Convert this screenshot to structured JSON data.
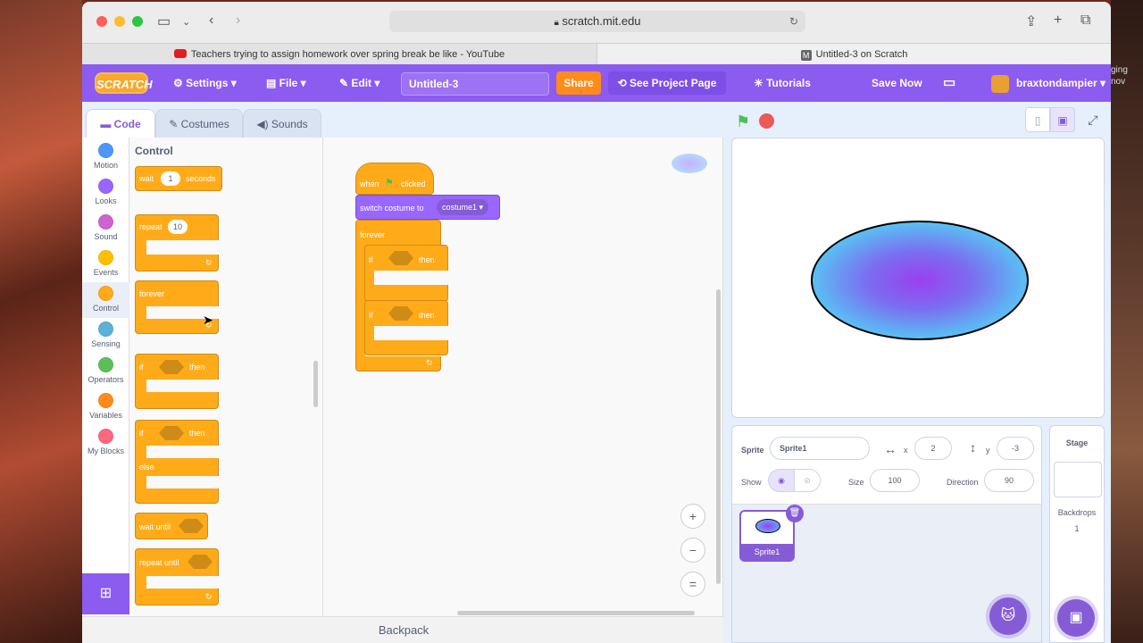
{
  "browser": {
    "url": "scratch.mit.edu",
    "tabs": [
      {
        "label": "Teachers trying to assign homework over spring break be like - YouTube"
      },
      {
        "label": "Untitled-3 on Scratch"
      }
    ],
    "background_side_text": "ging\nnov"
  },
  "menubar": {
    "logo": "SCRATCH",
    "settings": "Settings",
    "file": "File",
    "edit": "Edit",
    "project_title": "Untitled-3",
    "share": "Share",
    "see_project": "See Project Page",
    "tutorials": "Tutorials",
    "save_now": "Save Now",
    "username": "braxtondampier"
  },
  "editor_tabs": {
    "code": "Code",
    "costumes": "Costumes",
    "sounds": "Sounds"
  },
  "categories": [
    {
      "label": "Motion",
      "color": "#4c97ff"
    },
    {
      "label": "Looks",
      "color": "#9966ff"
    },
    {
      "label": "Sound",
      "color": "#cf63cf"
    },
    {
      "label": "Events",
      "color": "#ffbf00"
    },
    {
      "label": "Control",
      "color": "#ffab19"
    },
    {
      "label": "Sensing",
      "color": "#5cb1d6"
    },
    {
      "label": "Operators",
      "color": "#59c059"
    },
    {
      "label": "Variables",
      "color": "#ff8c1a"
    },
    {
      "label": "My Blocks",
      "color": "#ff6680"
    }
  ],
  "palette": {
    "title": "Control",
    "wait": "wait",
    "wait_value": "1",
    "seconds": "seconds",
    "repeat": "repeat",
    "repeat_value": "10",
    "forever": "forever",
    "if": "if",
    "then": "then",
    "else": "else",
    "wait_until": "wait until",
    "repeat_until": "repeat until"
  },
  "script": {
    "when": "when",
    "clicked": "clicked",
    "switch_costume": "switch costume to",
    "costume": "costume1",
    "forever": "forever",
    "if": "if",
    "then": "then"
  },
  "zoom": {
    "in": "+",
    "out": "−",
    "reset": "="
  },
  "backpack": "Backpack",
  "sprite_info": {
    "sprite_label": "Sprite",
    "sprite_name": "Sprite1",
    "x_label": "x",
    "x_value": "2",
    "y_label": "y",
    "y_value": "-3",
    "show_label": "Show",
    "size_label": "Size",
    "size_value": "100",
    "direction_label": "Direction",
    "direction_value": "90"
  },
  "sprite_list": [
    {
      "name": "Sprite1"
    }
  ],
  "stage_pane": {
    "title": "Stage",
    "backdrops_label": "Backdrops",
    "backdrops_count": "1"
  }
}
